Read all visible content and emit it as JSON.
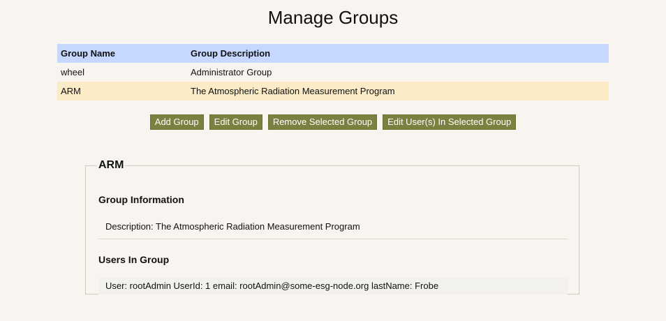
{
  "page": {
    "title": "Manage Groups"
  },
  "table": {
    "headers": {
      "name": "Group Name",
      "description": "Group Description"
    },
    "rows": [
      {
        "name": "wheel",
        "description": "Administrator Group"
      },
      {
        "name": "ARM",
        "description": "The Atmospheric Radiation Measurement Program"
      }
    ]
  },
  "buttons": {
    "add": "Add Group",
    "edit": "Edit Group",
    "remove": "Remove Selected Group",
    "edit_users": "Edit User(s) In Selected Group"
  },
  "detail": {
    "legend": "ARM",
    "group_info_heading": "Group Information",
    "description_line": "Description: The Atmospheric Radiation Measurement Program",
    "users_heading": "Users In Group",
    "users": [
      "User: rootAdmin UserId: 1 email: rootAdmin@some-esg-node.org lastName: Frobe"
    ]
  },
  "colors": {
    "header_bg": "#c6d8ff",
    "selected_row_bg": "#fbecc7",
    "button_bg": "#7b8040",
    "page_bg": "#f8f5f0"
  }
}
